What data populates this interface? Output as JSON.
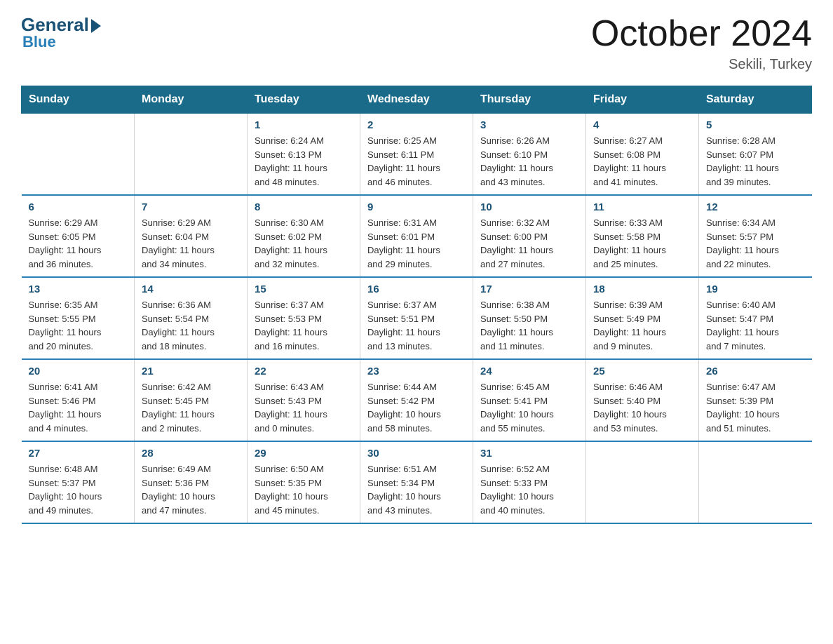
{
  "header": {
    "logo_general": "General",
    "logo_blue": "Blue",
    "main_title": "October 2024",
    "subtitle": "Sekili, Turkey"
  },
  "weekdays": [
    "Sunday",
    "Monday",
    "Tuesday",
    "Wednesday",
    "Thursday",
    "Friday",
    "Saturday"
  ],
  "weeks": [
    [
      {
        "day": "",
        "info": ""
      },
      {
        "day": "",
        "info": ""
      },
      {
        "day": "1",
        "info": "Sunrise: 6:24 AM\nSunset: 6:13 PM\nDaylight: 11 hours\nand 48 minutes."
      },
      {
        "day": "2",
        "info": "Sunrise: 6:25 AM\nSunset: 6:11 PM\nDaylight: 11 hours\nand 46 minutes."
      },
      {
        "day": "3",
        "info": "Sunrise: 6:26 AM\nSunset: 6:10 PM\nDaylight: 11 hours\nand 43 minutes."
      },
      {
        "day": "4",
        "info": "Sunrise: 6:27 AM\nSunset: 6:08 PM\nDaylight: 11 hours\nand 41 minutes."
      },
      {
        "day": "5",
        "info": "Sunrise: 6:28 AM\nSunset: 6:07 PM\nDaylight: 11 hours\nand 39 minutes."
      }
    ],
    [
      {
        "day": "6",
        "info": "Sunrise: 6:29 AM\nSunset: 6:05 PM\nDaylight: 11 hours\nand 36 minutes."
      },
      {
        "day": "7",
        "info": "Sunrise: 6:29 AM\nSunset: 6:04 PM\nDaylight: 11 hours\nand 34 minutes."
      },
      {
        "day": "8",
        "info": "Sunrise: 6:30 AM\nSunset: 6:02 PM\nDaylight: 11 hours\nand 32 minutes."
      },
      {
        "day": "9",
        "info": "Sunrise: 6:31 AM\nSunset: 6:01 PM\nDaylight: 11 hours\nand 29 minutes."
      },
      {
        "day": "10",
        "info": "Sunrise: 6:32 AM\nSunset: 6:00 PM\nDaylight: 11 hours\nand 27 minutes."
      },
      {
        "day": "11",
        "info": "Sunrise: 6:33 AM\nSunset: 5:58 PM\nDaylight: 11 hours\nand 25 minutes."
      },
      {
        "day": "12",
        "info": "Sunrise: 6:34 AM\nSunset: 5:57 PM\nDaylight: 11 hours\nand 22 minutes."
      }
    ],
    [
      {
        "day": "13",
        "info": "Sunrise: 6:35 AM\nSunset: 5:55 PM\nDaylight: 11 hours\nand 20 minutes."
      },
      {
        "day": "14",
        "info": "Sunrise: 6:36 AM\nSunset: 5:54 PM\nDaylight: 11 hours\nand 18 minutes."
      },
      {
        "day": "15",
        "info": "Sunrise: 6:37 AM\nSunset: 5:53 PM\nDaylight: 11 hours\nand 16 minutes."
      },
      {
        "day": "16",
        "info": "Sunrise: 6:37 AM\nSunset: 5:51 PM\nDaylight: 11 hours\nand 13 minutes."
      },
      {
        "day": "17",
        "info": "Sunrise: 6:38 AM\nSunset: 5:50 PM\nDaylight: 11 hours\nand 11 minutes."
      },
      {
        "day": "18",
        "info": "Sunrise: 6:39 AM\nSunset: 5:49 PM\nDaylight: 11 hours\nand 9 minutes."
      },
      {
        "day": "19",
        "info": "Sunrise: 6:40 AM\nSunset: 5:47 PM\nDaylight: 11 hours\nand 7 minutes."
      }
    ],
    [
      {
        "day": "20",
        "info": "Sunrise: 6:41 AM\nSunset: 5:46 PM\nDaylight: 11 hours\nand 4 minutes."
      },
      {
        "day": "21",
        "info": "Sunrise: 6:42 AM\nSunset: 5:45 PM\nDaylight: 11 hours\nand 2 minutes."
      },
      {
        "day": "22",
        "info": "Sunrise: 6:43 AM\nSunset: 5:43 PM\nDaylight: 11 hours\nand 0 minutes."
      },
      {
        "day": "23",
        "info": "Sunrise: 6:44 AM\nSunset: 5:42 PM\nDaylight: 10 hours\nand 58 minutes."
      },
      {
        "day": "24",
        "info": "Sunrise: 6:45 AM\nSunset: 5:41 PM\nDaylight: 10 hours\nand 55 minutes."
      },
      {
        "day": "25",
        "info": "Sunrise: 6:46 AM\nSunset: 5:40 PM\nDaylight: 10 hours\nand 53 minutes."
      },
      {
        "day": "26",
        "info": "Sunrise: 6:47 AM\nSunset: 5:39 PM\nDaylight: 10 hours\nand 51 minutes."
      }
    ],
    [
      {
        "day": "27",
        "info": "Sunrise: 6:48 AM\nSunset: 5:37 PM\nDaylight: 10 hours\nand 49 minutes."
      },
      {
        "day": "28",
        "info": "Sunrise: 6:49 AM\nSunset: 5:36 PM\nDaylight: 10 hours\nand 47 minutes."
      },
      {
        "day": "29",
        "info": "Sunrise: 6:50 AM\nSunset: 5:35 PM\nDaylight: 10 hours\nand 45 minutes."
      },
      {
        "day": "30",
        "info": "Sunrise: 6:51 AM\nSunset: 5:34 PM\nDaylight: 10 hours\nand 43 minutes."
      },
      {
        "day": "31",
        "info": "Sunrise: 6:52 AM\nSunset: 5:33 PM\nDaylight: 10 hours\nand 40 minutes."
      },
      {
        "day": "",
        "info": ""
      },
      {
        "day": "",
        "info": ""
      }
    ]
  ]
}
